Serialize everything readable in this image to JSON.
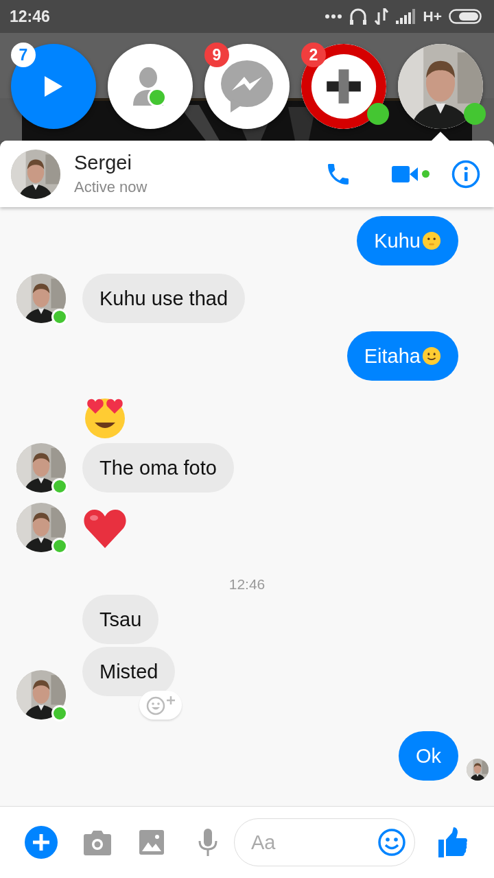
{
  "status_bar": {
    "time": "12:46",
    "network": "H+"
  },
  "chat_heads": [
    {
      "kind": "play",
      "badge": "7",
      "online": false,
      "selected": false
    },
    {
      "kind": "contacts",
      "online": true,
      "selected": false
    },
    {
      "kind": "messenger",
      "badge": "9",
      "online": false,
      "selected": false
    },
    {
      "kind": "ring_avatar",
      "badge": "2",
      "online": true,
      "selected": false
    },
    {
      "kind": "photo_avatar",
      "online": true,
      "selected": true
    }
  ],
  "header": {
    "name": "Sergei",
    "status": "Active now",
    "video_online": true
  },
  "messages": [
    {
      "kind": "sent",
      "text": "Kuhu",
      "emoji": {
        "kind": "hushed"
      }
    },
    {
      "kind": "received",
      "text": "Kuhu use thad",
      "avatar": true,
      "online": true
    },
    {
      "kind": "sent",
      "text": "Eitaha",
      "emoji": {
        "kind": "smile"
      }
    },
    {
      "kind": "received_emoji",
      "emoji": {
        "kind": "heart_eyes"
      },
      "avatar": false
    },
    {
      "kind": "received",
      "text": "The oma foto",
      "avatar": true,
      "online": true
    },
    {
      "kind": "received_emoji",
      "emoji": {
        "kind": "heart"
      },
      "avatar": true,
      "online": true
    },
    {
      "kind": "timestamp",
      "text": "12:46"
    },
    {
      "kind": "received",
      "text": "Tsau",
      "avatar": false
    },
    {
      "kind": "received",
      "text": "Misted",
      "avatar": true,
      "online": true,
      "reaction_button": true
    },
    {
      "kind": "sent",
      "text": "Ok",
      "seen": true
    }
  ],
  "composer": {
    "placeholder": "Aa"
  }
}
